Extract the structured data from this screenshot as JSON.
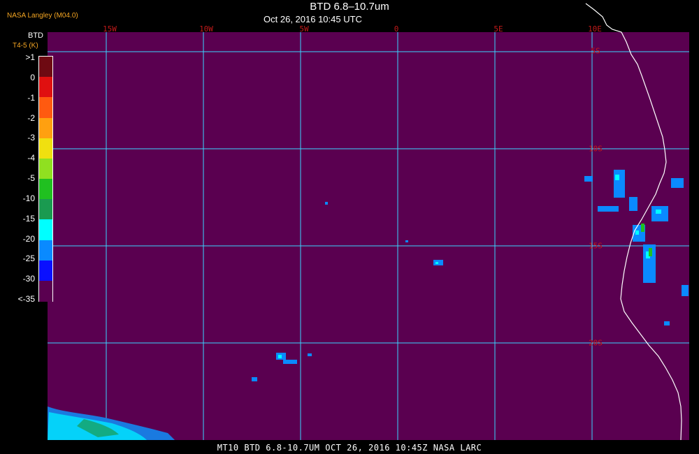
{
  "header": {
    "title": "BTD 6.8–10.7um",
    "date": "Oct 26, 2016 10:45 UTC",
    "source": "NASA Langley (M04.0)"
  },
  "colorbar": {
    "title": "BTD",
    "units": "T4-5 (K)",
    "labels": [
      ">1",
      "0",
      "-1",
      "-2",
      "-3",
      "-4",
      "-5",
      "-10",
      "-15",
      "-20",
      "-25",
      "-30",
      "<-35"
    ],
    "colors": [
      "#6e0a12",
      "#e01010",
      "#ff5a10",
      "#ffa010",
      "#f0e010",
      "#90e020",
      "#20c020",
      "#1a9a50",
      "#00ffff",
      "#0a8aff",
      "#0a10ff",
      "#5a0050"
    ]
  },
  "grid": {
    "lon_labels": [
      "15W",
      "10W",
      "5W",
      "0",
      "5E",
      "10E"
    ],
    "lat_labels": [
      "5S",
      "10S",
      "15S",
      "20S"
    ],
    "line_color": "#3ad6ff"
  },
  "map": {
    "background": "#5a0050",
    "coastline_color": "#ffffff"
  },
  "footer": {
    "text": "MT10   BTD 6.8-10.7UM   OCT 26, 2016 10:45Z   NASA LARC"
  }
}
